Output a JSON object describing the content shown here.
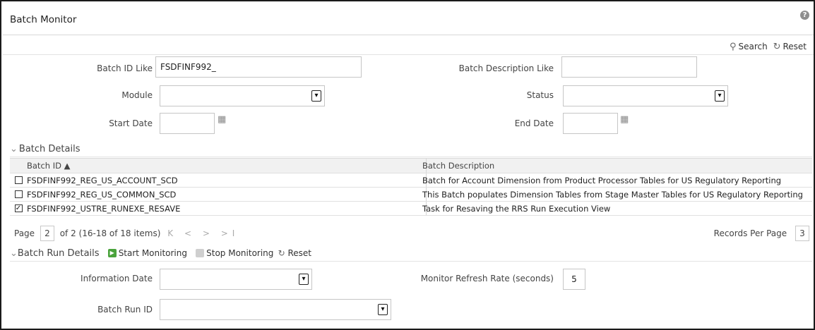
{
  "header": {
    "title": "Batch Monitor",
    "help_icon": "?"
  },
  "toolbar": {
    "search_label": "Search",
    "reset_label": "Reset",
    "search_icon": "search-icon",
    "reset_icon": "reset-icon"
  },
  "filters": {
    "batch_id_label": "Batch ID Like",
    "batch_id_value": "FSDFINF992_",
    "batch_desc_label": "Batch Description Like",
    "batch_desc_value": "",
    "module_label": "Module",
    "module_value": "",
    "status_label": "Status",
    "status_value": "",
    "start_date_label": "Start Date",
    "start_date_value": "",
    "end_date_label": "End Date",
    "end_date_value": ""
  },
  "batch_details": {
    "title": "Batch Details",
    "columns": [
      "Batch ID ▲",
      "Batch Description"
    ],
    "rows": [
      {
        "checked": false,
        "id": "FSDFINF992_REG_US_ACCOUNT_SCD",
        "desc": "Batch for Account Dimension from Product Processor Tables for US Regulatory Reporting"
      },
      {
        "checked": false,
        "id": "FSDFINF992_REG_US_COMMON_SCD",
        "desc": "This Batch populates Dimension Tables from Stage Master Tables for US Regulatory Reporting"
      },
      {
        "checked": true,
        "id": "FSDFINF992_USTRE_RUNEXE_RESAVE",
        "desc": "Task for Resaving the RRS Run Execution View"
      }
    ]
  },
  "pager": {
    "page_label": "Page",
    "page_value": "2",
    "page_info": "of 2 (16-18 of 18 items)",
    "nav": "K < > >I",
    "records_label": "Records Per Page",
    "records_value": "3"
  },
  "run_details": {
    "title": "Batch Run Details",
    "start_label": "Start Monitoring",
    "stop_label": "Stop Monitoring",
    "reset_label": "Reset",
    "info_date_label": "Information Date",
    "info_date_value": "",
    "refresh_label": "Monitor Refresh Rate (seconds)",
    "refresh_value": "5",
    "run_id_label": "Batch Run ID",
    "run_id_value": ""
  }
}
